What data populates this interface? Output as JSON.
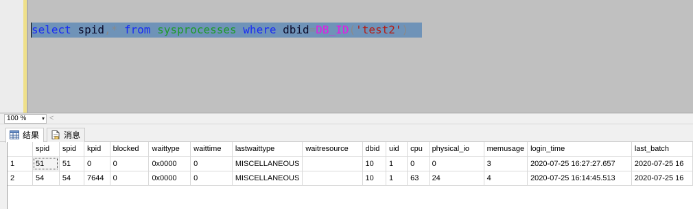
{
  "editor": {
    "tokens": [
      {
        "text": "select",
        "kind": "keyword"
      },
      {
        "text": " ",
        "kind": "space"
      },
      {
        "text": "spid",
        "kind": "identifier"
      },
      {
        "text": ",",
        "kind": "operator"
      },
      {
        "text": "*",
        "kind": "operator"
      },
      {
        "text": " ",
        "kind": "space"
      },
      {
        "text": "from",
        "kind": "keyword"
      },
      {
        "text": " ",
        "kind": "space"
      },
      {
        "text": "sysprocesses",
        "kind": "system-object"
      },
      {
        "text": " ",
        "kind": "space"
      },
      {
        "text": "where",
        "kind": "keyword"
      },
      {
        "text": " ",
        "kind": "space"
      },
      {
        "text": "dbid",
        "kind": "identifier"
      },
      {
        "text": "=",
        "kind": "operator"
      },
      {
        "text": "DB_ID",
        "kind": "function"
      },
      {
        "text": "(",
        "kind": "operator"
      },
      {
        "text": "'test2'",
        "kind": "string"
      },
      {
        "text": ")",
        "kind": "operator"
      }
    ]
  },
  "zoom": {
    "value": "100 %",
    "arrow": "▾",
    "scroll_left": "<"
  },
  "tabs": {
    "results_label": "结果",
    "messages_label": "消息"
  },
  "grid": {
    "columns": [
      "",
      "spid",
      "spid",
      "kpid",
      "blocked",
      "waittype",
      "waittime",
      "lastwaittype",
      "waitresource",
      "dbid",
      "uid",
      "cpu",
      "physical_io",
      "memusage",
      "login_time",
      "last_batch"
    ],
    "rows": [
      [
        "1",
        "51",
        "51",
        "0",
        "0",
        "0x0000",
        "0",
        "MISCELLANEOUS",
        "",
        "10",
        "1",
        "0",
        "0",
        "3",
        "2020-07-25 16:27:27.657",
        "2020-07-25 16"
      ],
      [
        "2",
        "54",
        "54",
        "7644",
        "0",
        "0x0000",
        "0",
        "MISCELLANEOUS",
        "",
        "10",
        "1",
        "63",
        "24",
        "4",
        "2020-07-25 16:14:45.513",
        "2020-07-25 16"
      ]
    ]
  },
  "colors": {
    "keyword": "#1a2df2",
    "system_object": "#1f9a2a",
    "function": "#e21ce4",
    "string": "#b41d15",
    "selection": "#6f93b8",
    "editor_bg": "#c0c0c0"
  }
}
